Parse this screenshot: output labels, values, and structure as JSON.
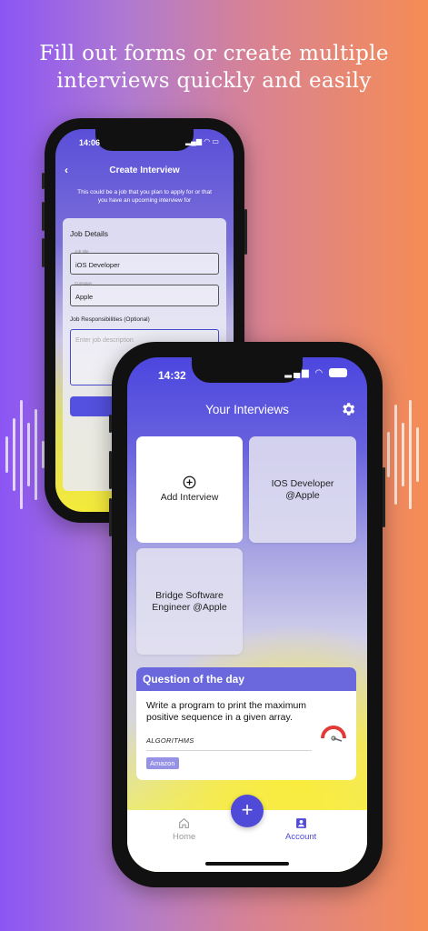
{
  "headline": {
    "line1": "Fill out forms or create multiple",
    "line2": "interviews quickly and easily"
  },
  "back_phone": {
    "status_time": "14:06",
    "title": "Create Interview",
    "subtitle": "This could be a job that you plan to apply for or that you have an upcoming interview for",
    "form": {
      "section_title": "Job Details",
      "job_title_label": "Job title",
      "job_title_value": "iOS Developer",
      "company_label": "Company",
      "company_value": "Apple",
      "responsibilities_label": "Job Responsibilities (Optional)",
      "description_placeholder": "Enter job description"
    }
  },
  "front_phone": {
    "status_time": "14:32",
    "title": "Your Interviews",
    "add_interview_label": "Add Interview",
    "interviews": [
      {
        "label": "IOS Developer @Apple"
      },
      {
        "label": "Bridge Software Engineer @Apple"
      }
    ],
    "question_of_the_day": {
      "heading": "Question of the day",
      "question": "Write a program to print the maximum positive sequence in a given array.",
      "category": "ALGORITHMS",
      "company_tag": "Amazon",
      "difficulty_color": "#e53935"
    },
    "tabs": [
      {
        "label": "Home",
        "icon": "home-icon",
        "active": false
      },
      {
        "label": "Account",
        "icon": "account-icon",
        "active": true
      }
    ],
    "fab_label": "+"
  },
  "colors": {
    "accent": "#4f4ad8",
    "bg_left": "#8b55f5",
    "bg_right": "#f58c55"
  }
}
